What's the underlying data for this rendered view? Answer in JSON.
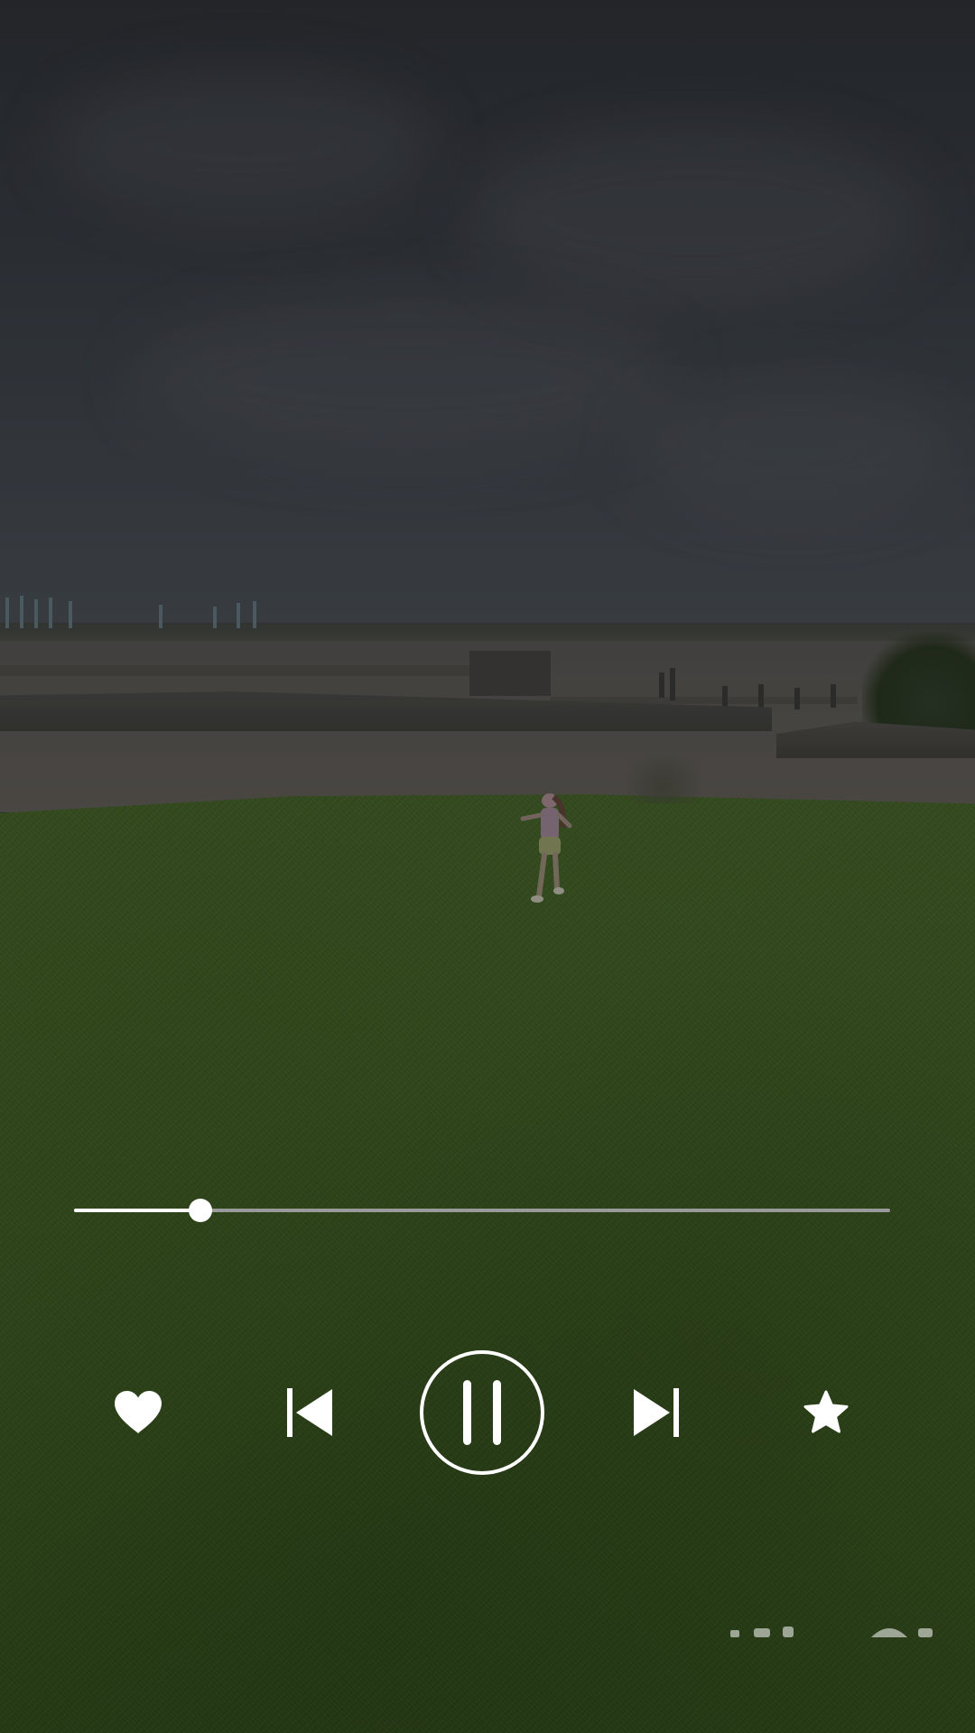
{
  "player": {
    "playback_progress": 0.155,
    "state": "playing",
    "controls": [
      {
        "name": "heart-icon",
        "label": "like"
      },
      {
        "name": "skip-previous-icon",
        "label": "previous"
      },
      {
        "name": "pause-icon",
        "label": "pause"
      },
      {
        "name": "skip-next-icon",
        "label": "next"
      },
      {
        "name": "star-icon",
        "label": "favorite"
      }
    ]
  },
  "colors": {
    "controls": "#ffffff",
    "seek_track": "#9a9a9a",
    "seek_progress": "#ffffff",
    "overlay_dim": "#000000"
  },
  "scene": "video frame"
}
